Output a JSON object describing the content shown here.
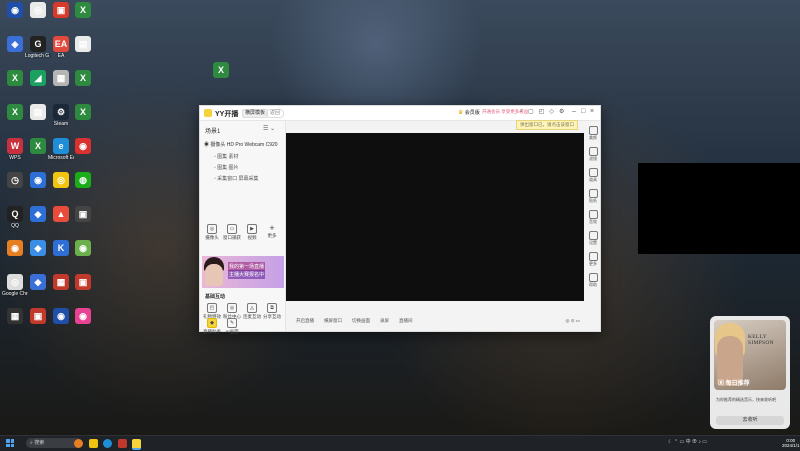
{
  "desktop": {
    "icons": [
      {
        "label": "",
        "color": "#1f4fa8",
        "glyph": "◉",
        "name": "desktop-icon-1"
      },
      {
        "label": "",
        "color": "#eaeaea",
        "glyph": "◎",
        "name": "desktop-icon-2"
      },
      {
        "label": "",
        "color": "#d43b2a",
        "glyph": "▣",
        "name": "desktop-icon-3"
      },
      {
        "label": "",
        "color": "#2d8a3e",
        "glyph": "X",
        "name": "desktop-icon-4"
      },
      {
        "label": "",
        "color": "#3a6fd8",
        "glyph": "◈",
        "name": "desktop-icon-5"
      },
      {
        "label": "Logitech G HUB",
        "color": "#222",
        "glyph": "G",
        "name": "desktop-icon-ghub"
      },
      {
        "label": "EA",
        "color": "#e0493b",
        "glyph": "EA",
        "name": "desktop-icon-ea"
      },
      {
        "label": "",
        "color": "#eaeaea",
        "glyph": "▤",
        "name": "desktop-icon-6"
      },
      {
        "label": "",
        "color": "#2d8a3e",
        "glyph": "X",
        "name": "desktop-icon-7"
      },
      {
        "label": "",
        "color": "#1aa160",
        "glyph": "◢",
        "name": "desktop-icon-8"
      },
      {
        "label": "",
        "color": "#b5b5b5",
        "glyph": "▦",
        "name": "desktop-icon-9"
      },
      {
        "label": "",
        "color": "#2d8a3e",
        "glyph": "X",
        "name": "desktop-icon-10"
      },
      {
        "label": "",
        "color": "#2d8a3e",
        "glyph": "X",
        "name": "desktop-icon-11"
      },
      {
        "label": "",
        "color": "#eaeaea",
        "glyph": "▤",
        "name": "desktop-icon-12"
      },
      {
        "label": "Steam",
        "color": "#1b2838",
        "glyph": "⚙",
        "name": "desktop-icon-steam"
      },
      {
        "label": "",
        "color": "#2d8a3e",
        "glyph": "X",
        "name": "desktop-icon-13"
      },
      {
        "label": "WPS",
        "color": "#c8303d",
        "glyph": "W",
        "name": "desktop-icon-wps"
      },
      {
        "label": "",
        "color": "#2d8a3e",
        "glyph": "X",
        "name": "desktop-icon-14"
      },
      {
        "label": "Microsoft Edge",
        "color": "#1e8fd6",
        "glyph": "e",
        "name": "desktop-icon-edge"
      },
      {
        "label": "",
        "color": "#d8312f",
        "glyph": "◉",
        "name": "desktop-icon-15"
      },
      {
        "label": "",
        "color": "#444",
        "glyph": "◷",
        "name": "desktop-icon-16"
      },
      {
        "label": "",
        "color": "#2d6fd6",
        "glyph": "◉",
        "name": "desktop-icon-17"
      },
      {
        "label": "",
        "color": "#f1c40f",
        "glyph": "◎",
        "name": "desktop-icon-18"
      },
      {
        "label": "",
        "color": "#1aad19",
        "glyph": "◍",
        "name": "desktop-icon-wechat"
      },
      {
        "label": "QQ",
        "color": "#222",
        "glyph": "Q",
        "name": "desktop-icon-qq"
      },
      {
        "label": "",
        "color": "#2d6fd6",
        "glyph": "◆",
        "name": "desktop-icon-19"
      },
      {
        "label": "",
        "color": "#e74c3c",
        "glyph": "▲",
        "name": "desktop-icon-20"
      },
      {
        "label": "",
        "color": "#444",
        "glyph": "▣",
        "name": "desktop-icon-21"
      },
      {
        "label": "",
        "color": "#e67e22",
        "glyph": "◉",
        "name": "desktop-icon-22"
      },
      {
        "label": "",
        "color": "#3a8ee6",
        "glyph": "◆",
        "name": "desktop-icon-23"
      },
      {
        "label": "",
        "color": "#2d6fd6",
        "glyph": "K",
        "name": "desktop-icon-24"
      },
      {
        "label": "",
        "color": "#6ab04c",
        "glyph": "◉",
        "name": "desktop-icon-25"
      },
      {
        "label": "Google Chrome",
        "color": "#ddd",
        "glyph": "◎",
        "name": "desktop-icon-chrome"
      },
      {
        "label": "",
        "color": "#3a6fd8",
        "glyph": "◆",
        "name": "desktop-icon-26"
      },
      {
        "label": "",
        "color": "#c0392b",
        "glyph": "▦",
        "name": "desktop-icon-27"
      },
      {
        "label": "",
        "color": "#c0392b",
        "glyph": "▣",
        "name": "desktop-icon-28"
      },
      {
        "label": "",
        "color": "#333",
        "glyph": "▦",
        "name": "desktop-icon-29"
      },
      {
        "label": "",
        "color": "#c0392b",
        "glyph": "▣",
        "name": "desktop-icon-30"
      },
      {
        "label": "",
        "color": "#1f4fa8",
        "glyph": "◉",
        "name": "desktop-icon-31"
      },
      {
        "label": "",
        "color": "#e84393",
        "glyph": "◉",
        "name": "desktop-icon-32"
      }
    ]
  },
  "yy": {
    "app_name": "YY开播",
    "mode_label": "横屏模板",
    "back_label": "返回",
    "member_label": "会员版",
    "pink_text": "开通会员 享受更多权益",
    "tooltip": "弹出窗口已，请点击该窗口",
    "scene_title": "场景1",
    "sources": {
      "main": "摄像头 HD Pro Webcam C920",
      "sub1": "图集 素材",
      "sub2": "图集 图片",
      "sub3": "采集窗口 屏幕采集"
    },
    "tools": [
      {
        "label": "摄像头",
        "icon": "camera-icon"
      },
      {
        "label": "窗口捕获",
        "icon": "window-icon"
      },
      {
        "label": "视频",
        "icon": "video-icon"
      },
      {
        "label": "更多",
        "icon": "plus-icon"
      }
    ],
    "banner_line1": "我的第一场直播",
    "banner_line2": "主播大赛报名中",
    "basic_title": "基础互动",
    "basic_tools": [
      {
        "label": "礼物特效",
        "icon": "gift-icon"
      },
      {
        "label": "粉丝中心",
        "icon": "fans-icon"
      },
      {
        "label": "连麦互动",
        "icon": "link-icon"
      },
      {
        "label": "分享互动",
        "icon": "share-icon"
      }
    ],
    "extra_tools": [
      {
        "label": "直播助手",
        "icon": "assistant-icon"
      },
      {
        "label": "AI画面",
        "icon": "ai-icon"
      }
    ],
    "bottom_bar": [
      "开启直播",
      "横屏窗口",
      "切换画面",
      "录屏",
      "直播间"
    ],
    "right_tools": [
      {
        "label": "美颜",
        "icon": "beauty-icon"
      },
      {
        "label": "滤镜",
        "icon": "filter-icon"
      },
      {
        "label": "道具",
        "icon": "prop-icon"
      },
      {
        "label": "贴纸",
        "icon": "sticker-icon"
      },
      {
        "label": "音效",
        "icon": "sound-icon"
      },
      {
        "label": "设置",
        "icon": "settings-icon"
      },
      {
        "label": "更多",
        "icon": "more-icon"
      },
      {
        "label": "帮助",
        "icon": "help-icon"
      }
    ]
  },
  "notification": {
    "artist": "KELLY SIMPSON",
    "daily": "每日推荐",
    "desc": "为你推荐的精选音乐，快来收听吧",
    "button": "去收听"
  },
  "taskbar": {
    "search": "搜索",
    "tray_text": "中",
    "time": "0:00",
    "date": "2024/1/1"
  }
}
